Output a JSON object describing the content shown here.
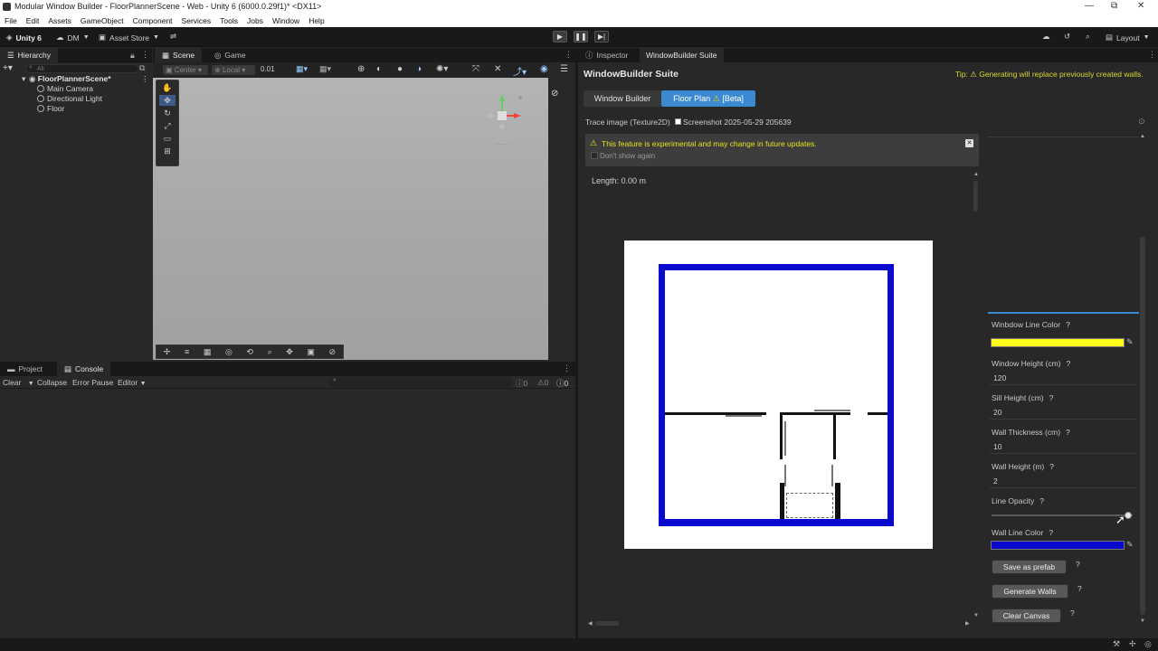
{
  "window": {
    "title": "Modular Window Builder - FloorPlannerScene - Web - Unity 6 (6000.0.29f1)* <DX11>",
    "controls": [
      "—",
      "⧉",
      "✕"
    ]
  },
  "menu": [
    "File",
    "Edit",
    "Assets",
    "GameObject",
    "Component",
    "Services",
    "Tools",
    "Jobs",
    "Window",
    "Help"
  ],
  "toolbar": {
    "unity_label": "Unity 6",
    "account_label": "DM",
    "asset_store_label": "Asset Store",
    "layout_label": "Layout"
  },
  "hierarchy": {
    "tab_label": "Hierarchy",
    "search_placeholder": "All",
    "scene_name": "FloorPlannerScene*",
    "items": [
      "Main Camera",
      "Directional Light",
      "Floor"
    ]
  },
  "scene": {
    "tab_scene": "Scene",
    "tab_game": "Game",
    "pivot_label": "Center",
    "space_label": "Local",
    "snap_value": "0.01"
  },
  "bottom": {
    "tab_project": "Project",
    "tab_console": "Console",
    "clear_label": "Clear",
    "collapse_label": "Collapse",
    "error_pause_label": "Error Pause",
    "editor_label": "Editor",
    "count_logs": "0",
    "count_warnings": "0",
    "count_errors": "0"
  },
  "right": {
    "tab_inspector": "Inspector",
    "tab_suite": "WindowBuilder Suite",
    "suite_title": "WindowBuilder Suite",
    "tip_label": "Tip:",
    "tip_text": "Generating will replace previously created walls.",
    "subtab_window_builder": "Window Builder",
    "subtab_floor_plan": "Floor Plan",
    "subtab_beta": "[Beta]",
    "trace_label": "Trace image (Texture2D)",
    "trace_value": "Screenshot 2025-05-29 205639",
    "warning_text": "This feature is experimental and may change in future updates.",
    "dont_show_again": "Don't show again",
    "length_label": "Length: 0.00 m",
    "window_line_color_label": "Winbdow Line Color",
    "window_line_color": "#ffff1a",
    "window_height_label": "Window Height (cm)",
    "window_height_value": "120",
    "sill_height_label": "Sill Height (cm)",
    "sill_height_value": "20",
    "wall_thickness_label": "Wall Thickness (cm)",
    "wall_thickness_value": "10",
    "wall_height_label": "Wall Height (m)",
    "wall_height_value": "2",
    "line_opacity_label": "Line Opacity",
    "line_opacity_value": 0.97,
    "wall_line_color_label": "Wall Line Color",
    "wall_line_color": "#0a0acf",
    "help_mark": "?",
    "save_prefab_label": "Save as prefab",
    "generate_walls_label": "Generate Walls",
    "clear_canvas_label": "Clear Canvas"
  },
  "colors": {
    "accent_blue": "#3b8ad1",
    "tip_yellow": "#d7d731",
    "warn_yellow": "#e6e21f"
  }
}
